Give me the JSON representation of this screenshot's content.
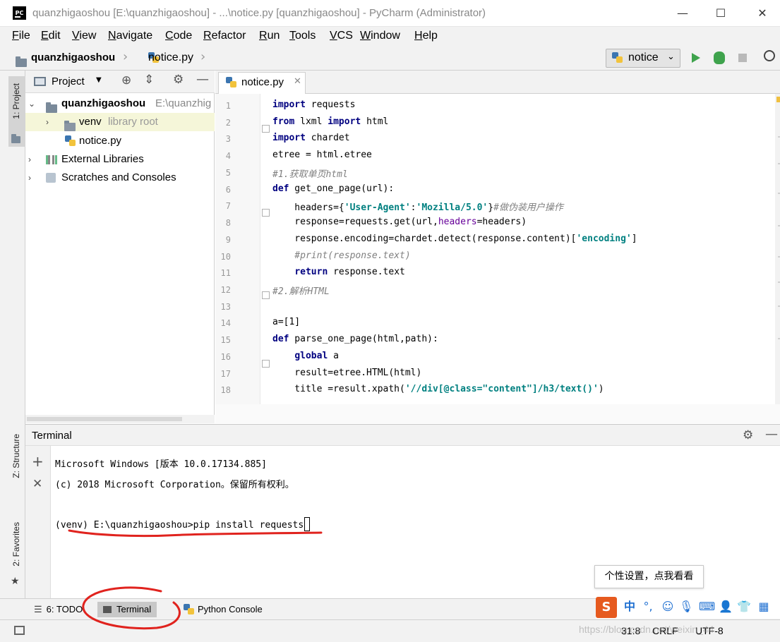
{
  "window": {
    "title": "quanzhigaoshou [E:\\quanzhigaoshou] - ...\\notice.py [quanzhigaoshou] - PyCharm (Administrator)",
    "app_icon_label": "PC",
    "minimize": "—",
    "maximize": "☐",
    "close": "✕"
  },
  "menu": [
    "File",
    "Edit",
    "View",
    "Navigate",
    "Code",
    "Refactor",
    "Run",
    "Tools",
    "VCS",
    "Window",
    "Help"
  ],
  "navbar": {
    "project": "quanzhigaoshou",
    "file": "notice.py",
    "run_config": "notice"
  },
  "side_tabs": {
    "project": "1: Project",
    "structure": "Z: Structure",
    "favorites": "2: Favorites"
  },
  "project_panel": {
    "title": "Project",
    "root_name": "quanzhigaoshou",
    "root_path": "E:\\quanzhig",
    "venv": "venv",
    "venv_note": "library root",
    "file": "notice.py",
    "external": "External Libraries",
    "scratches": "Scratches and Consoles"
  },
  "editor": {
    "tab": "notice.py",
    "line_numbers": [
      "1",
      "2",
      "3",
      "4",
      "5",
      "6",
      "7",
      "8",
      "9",
      "10",
      "11",
      "12",
      "13",
      "14",
      "15",
      "16",
      "17",
      "18"
    ]
  },
  "code": {
    "l1_kw": "import",
    "l1_rest": " requests",
    "l2_kw1": "from",
    "l2_mid": " lxml ",
    "l2_kw2": "import",
    "l2_rest": " html",
    "l3_kw": "import",
    "l3_rest": " chardet",
    "l4": "etree = html.etree",
    "l5": "#1.获取单页html",
    "l6_kw": "def",
    "l6_rest": " get_one_page(url):",
    "l7_a": "    headers={",
    "l7_s1": "'User-Agent'",
    "l7_b": ":",
    "l7_s2": "'Mozilla/5.0'",
    "l7_c": "}",
    "l7_cmt": "#做伪装用户操作",
    "l8_a": "    response=requests.get(url,",
    "l8_p": "headers",
    "l8_b": "=headers)",
    "l9_a": "    response.encoding=chardet.detect(response.content)[",
    "l9_s": "'encoding'",
    "l9_b": "]",
    "l10": "    #print(response.text)",
    "l11_ind": "    ",
    "l11_kw": "return",
    "l11_rest": " response.text",
    "l12": "#2.解析HTML",
    "l14": "a=[1]",
    "l15_kw": "def",
    "l15_rest": " parse_one_page(html,path):",
    "l16_ind": "    ",
    "l16_kw": "global",
    "l16_rest": " a",
    "l17": "    result=etree.HTML(html)",
    "l18_a": "    title =result.xpath(",
    "l18_s": "'//div[@class=\"content\"]/h3/text()'",
    "l18_b": ")"
  },
  "terminal": {
    "title": "Terminal",
    "line1": "Microsoft Windows [版本 10.0.17134.885]",
    "line2": "(c) 2018 Microsoft Corporation。保留所有权利。",
    "prompt": "(venv) E:\\quanzhigaoshou>pip install requests"
  },
  "bottom_tabs": {
    "todo": "6: TODO",
    "terminal": "Terminal",
    "python_console": "Python Console"
  },
  "status": {
    "position": "31:8",
    "line_sep": "CRLF",
    "encoding": "UTF-8"
  },
  "ime": {
    "tooltip": "个性设置，点我看看",
    "logo": "S",
    "lang": "中",
    "punct": "°,"
  },
  "watermark": "https://blog.csdn.net/weixin_44"
}
